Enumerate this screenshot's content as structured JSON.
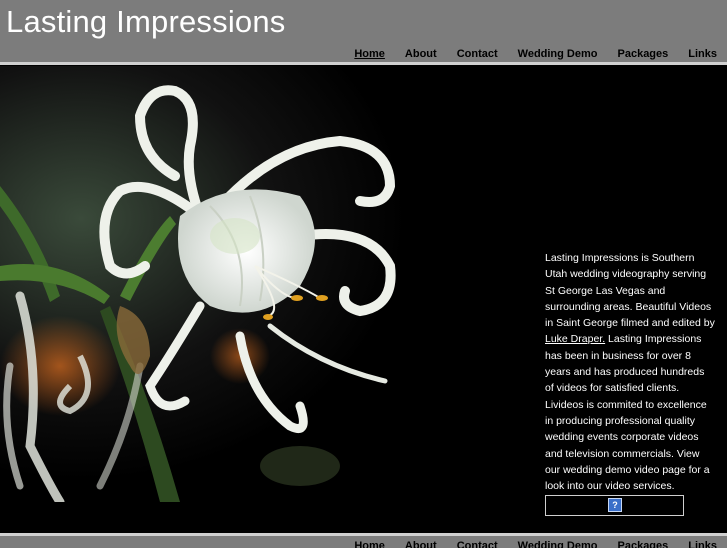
{
  "site": {
    "title": "Lasting Impressions"
  },
  "nav": {
    "items": [
      "Home",
      "About",
      "Contact",
      "Wedding Demo",
      "Packages",
      "Links"
    ]
  },
  "intro": {
    "before_link": "Lasting Impressions is Southern Utah wedding videography serving St George Las Vegas and surrounding areas. Beautiful Videos in Saint George filmed and edited by ",
    "link_text": "Luke Draper.",
    "after_link": " Lasting Impressions has been in business for over 8 years and has produced hundreds of videos for satisfied clients. Livideos is commited to excellence in producing professional quality wedding events corporate videos and television commercials. View our wedding demo video page for a look into our video services."
  },
  "badge": {
    "icon": "question-mark-icon",
    "glyph": "?"
  },
  "colors": {
    "header": "#7c7c7c",
    "background": "#000000",
    "rule": "#d0d0d0"
  }
}
